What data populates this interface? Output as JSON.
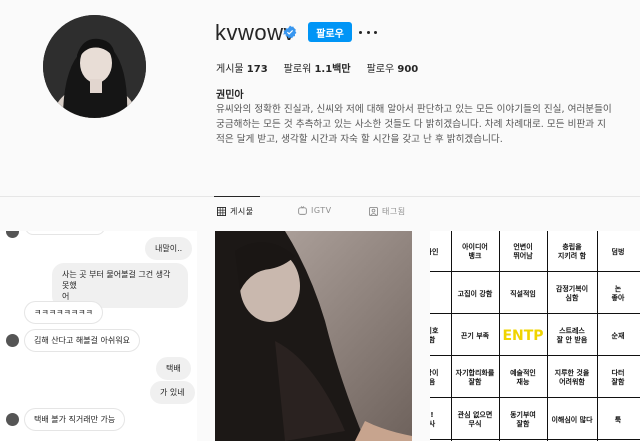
{
  "profile": {
    "username": "kvwowv",
    "follow_label": "팔로우",
    "stats": {
      "posts_label": "게시물",
      "posts_value": "173",
      "followers_label": "팔로워",
      "followers_value": "1.1백만",
      "following_label": "팔로우",
      "following_value": "900"
    },
    "full_name": "권민아",
    "bio": "유씨와의 정확한 진실과, 신씨와 저에 대해 알아서 판단하고 있는 모든 이야기들의 진실, 여러분들이 궁금해하는 모든 것 추측하고 있는 사소한 것들도 다 밝히겠습니다. 차례 차례대로. 모든 비판과 지적은 달게 받고, 생각할 시간과 자숙 할 시간을 갖고 난 후 밝히겠습니다."
  },
  "tabs": [
    {
      "label": "게시물",
      "icon": "grid-icon",
      "active": true
    },
    {
      "label": "IGTV",
      "icon": "igtv-icon",
      "active": false
    },
    {
      "label": "태그됨",
      "icon": "tagged-icon",
      "active": false
    }
  ],
  "chat": {
    "messages": [
      {
        "text": "내말이..",
        "side": "right"
      },
      {
        "text": "사는 곳 부터 물어볼걸 그건 생각 못했",
        "text2": "어",
        "side": "right"
      },
      {
        "text": "ㅋㅋㅋㅋㅋㅋㅋㅋ",
        "side": "left"
      },
      {
        "text": "김해 산다고 해볼걸 아쉬워요",
        "side": "left"
      },
      {
        "text": "택배",
        "side": "right"
      },
      {
        "text": "가 있네",
        "side": "right"
      },
      {
        "text": "택배 볼가 직거래만 가능",
        "side": "left"
      }
    ]
  },
  "mbti": {
    "cells": [
      [
        "마인",
        "아이디어\n뱅크",
        "언변이\n뛰어남",
        "충립을\n지키려 함",
        "덤벙"
      ],
      [
        "",
        "고집이 강함",
        "직설적임",
        "감정기복이\n심함",
        "논\n좋아"
      ],
      [
        "이호\n함",
        "끈기 부족",
        "ENTP",
        "스트레스\n잘 안 받음",
        "순재"
      ],
      [
        "장이\n음",
        "자기합리화를\n잘함",
        "예술적인\n재능",
        "지루한 것을\n어려워함",
        "다터\n잘함"
      ],
      [
        "!\n사",
        "관심 없으면\n무식",
        "동기부여\n잘함",
        "이해심이 많다",
        "툭"
      ]
    ]
  },
  "colors": {
    "accent": "#0095f6",
    "verified": "#3897f0",
    "mbti_highlight": "#f0d400"
  }
}
